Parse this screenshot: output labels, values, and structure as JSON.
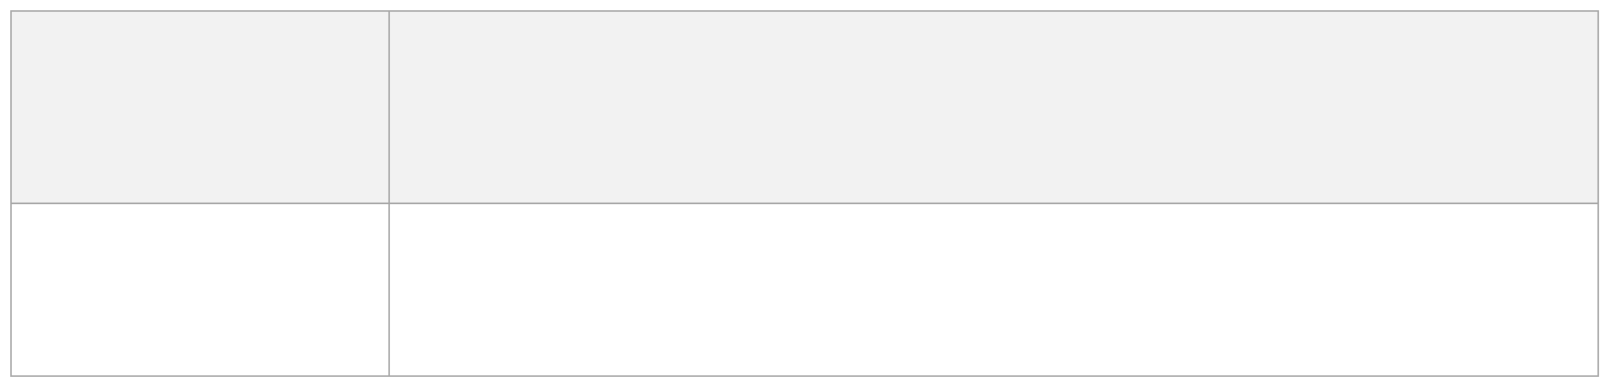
{
  "table": {
    "header": [
      "",
      ""
    ],
    "rows": [
      [
        "",
        ""
      ]
    ],
    "colors": {
      "header_background": "#f2f2f2",
      "body_background": "#ffffff",
      "border": "#a6a6a6"
    }
  }
}
